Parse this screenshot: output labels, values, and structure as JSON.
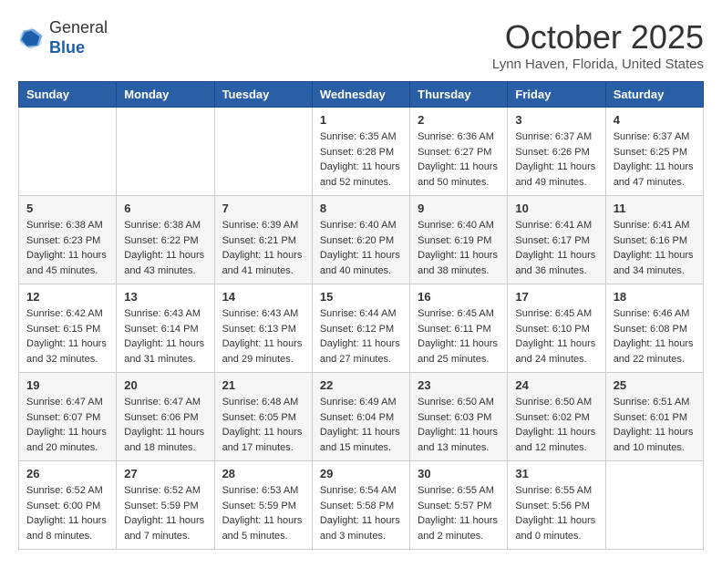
{
  "header": {
    "logo_line1": "General",
    "logo_line2": "Blue",
    "month_title": "October 2025",
    "subtitle": "Lynn Haven, Florida, United States"
  },
  "days_of_week": [
    "Sunday",
    "Monday",
    "Tuesday",
    "Wednesday",
    "Thursday",
    "Friday",
    "Saturday"
  ],
  "weeks": [
    [
      {
        "day": "",
        "info": ""
      },
      {
        "day": "",
        "info": ""
      },
      {
        "day": "",
        "info": ""
      },
      {
        "day": "1",
        "info": "Sunrise: 6:35 AM\nSunset: 6:28 PM\nDaylight: 11 hours\nand 52 minutes."
      },
      {
        "day": "2",
        "info": "Sunrise: 6:36 AM\nSunset: 6:27 PM\nDaylight: 11 hours\nand 50 minutes."
      },
      {
        "day": "3",
        "info": "Sunrise: 6:37 AM\nSunset: 6:26 PM\nDaylight: 11 hours\nand 49 minutes."
      },
      {
        "day": "4",
        "info": "Sunrise: 6:37 AM\nSunset: 6:25 PM\nDaylight: 11 hours\nand 47 minutes."
      }
    ],
    [
      {
        "day": "5",
        "info": "Sunrise: 6:38 AM\nSunset: 6:23 PM\nDaylight: 11 hours\nand 45 minutes."
      },
      {
        "day": "6",
        "info": "Sunrise: 6:38 AM\nSunset: 6:22 PM\nDaylight: 11 hours\nand 43 minutes."
      },
      {
        "day": "7",
        "info": "Sunrise: 6:39 AM\nSunset: 6:21 PM\nDaylight: 11 hours\nand 41 minutes."
      },
      {
        "day": "8",
        "info": "Sunrise: 6:40 AM\nSunset: 6:20 PM\nDaylight: 11 hours\nand 40 minutes."
      },
      {
        "day": "9",
        "info": "Sunrise: 6:40 AM\nSunset: 6:19 PM\nDaylight: 11 hours\nand 38 minutes."
      },
      {
        "day": "10",
        "info": "Sunrise: 6:41 AM\nSunset: 6:17 PM\nDaylight: 11 hours\nand 36 minutes."
      },
      {
        "day": "11",
        "info": "Sunrise: 6:41 AM\nSunset: 6:16 PM\nDaylight: 11 hours\nand 34 minutes."
      }
    ],
    [
      {
        "day": "12",
        "info": "Sunrise: 6:42 AM\nSunset: 6:15 PM\nDaylight: 11 hours\nand 32 minutes."
      },
      {
        "day": "13",
        "info": "Sunrise: 6:43 AM\nSunset: 6:14 PM\nDaylight: 11 hours\nand 31 minutes."
      },
      {
        "day": "14",
        "info": "Sunrise: 6:43 AM\nSunset: 6:13 PM\nDaylight: 11 hours\nand 29 minutes."
      },
      {
        "day": "15",
        "info": "Sunrise: 6:44 AM\nSunset: 6:12 PM\nDaylight: 11 hours\nand 27 minutes."
      },
      {
        "day": "16",
        "info": "Sunrise: 6:45 AM\nSunset: 6:11 PM\nDaylight: 11 hours\nand 25 minutes."
      },
      {
        "day": "17",
        "info": "Sunrise: 6:45 AM\nSunset: 6:10 PM\nDaylight: 11 hours\nand 24 minutes."
      },
      {
        "day": "18",
        "info": "Sunrise: 6:46 AM\nSunset: 6:08 PM\nDaylight: 11 hours\nand 22 minutes."
      }
    ],
    [
      {
        "day": "19",
        "info": "Sunrise: 6:47 AM\nSunset: 6:07 PM\nDaylight: 11 hours\nand 20 minutes."
      },
      {
        "day": "20",
        "info": "Sunrise: 6:47 AM\nSunset: 6:06 PM\nDaylight: 11 hours\nand 18 minutes."
      },
      {
        "day": "21",
        "info": "Sunrise: 6:48 AM\nSunset: 6:05 PM\nDaylight: 11 hours\nand 17 minutes."
      },
      {
        "day": "22",
        "info": "Sunrise: 6:49 AM\nSunset: 6:04 PM\nDaylight: 11 hours\nand 15 minutes."
      },
      {
        "day": "23",
        "info": "Sunrise: 6:50 AM\nSunset: 6:03 PM\nDaylight: 11 hours\nand 13 minutes."
      },
      {
        "day": "24",
        "info": "Sunrise: 6:50 AM\nSunset: 6:02 PM\nDaylight: 11 hours\nand 12 minutes."
      },
      {
        "day": "25",
        "info": "Sunrise: 6:51 AM\nSunset: 6:01 PM\nDaylight: 11 hours\nand 10 minutes."
      }
    ],
    [
      {
        "day": "26",
        "info": "Sunrise: 6:52 AM\nSunset: 6:00 PM\nDaylight: 11 hours\nand 8 minutes."
      },
      {
        "day": "27",
        "info": "Sunrise: 6:52 AM\nSunset: 5:59 PM\nDaylight: 11 hours\nand 7 minutes."
      },
      {
        "day": "28",
        "info": "Sunrise: 6:53 AM\nSunset: 5:59 PM\nDaylight: 11 hours\nand 5 minutes."
      },
      {
        "day": "29",
        "info": "Sunrise: 6:54 AM\nSunset: 5:58 PM\nDaylight: 11 hours\nand 3 minutes."
      },
      {
        "day": "30",
        "info": "Sunrise: 6:55 AM\nSunset: 5:57 PM\nDaylight: 11 hours\nand 2 minutes."
      },
      {
        "day": "31",
        "info": "Sunrise: 6:55 AM\nSunset: 5:56 PM\nDaylight: 11 hours\nand 0 minutes."
      },
      {
        "day": "",
        "info": ""
      }
    ]
  ]
}
